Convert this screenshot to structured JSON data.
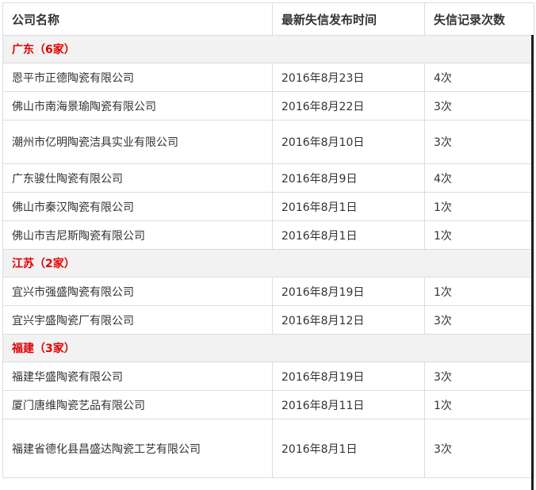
{
  "table": {
    "headers": {
      "company": "公司名称",
      "date": "最新失信发布时间",
      "count": "失信记录次数"
    },
    "groups": [
      {
        "title": "广东（6家）",
        "rows": [
          {
            "company": "恩平市正德陶瓷有限公司",
            "date": "2016年8月23日",
            "count": "4次"
          },
          {
            "company": "佛山市南海景瑜陶瓷有限公司",
            "date": "2016年8月22日",
            "count": "3次"
          },
          {
            "company": "潮州市亿明陶瓷洁具实业有限公司",
            "date": "2016年8月10日",
            "count": "3次"
          },
          {
            "company": "广东骏仕陶瓷有限公司",
            "date": "2016年8月9日",
            "count": "4次"
          },
          {
            "company": "佛山市秦汉陶瓷有限公司",
            "date": "2016年8月1日",
            "count": "1次"
          },
          {
            "company": "佛山市吉尼斯陶瓷有限公司",
            "date": "2016年8月1日",
            "count": "1次"
          }
        ]
      },
      {
        "title": "江苏（2家）",
        "rows": [
          {
            "company": "宜兴市强盛陶瓷有限公司",
            "date": "2016年8月19日",
            "count": "1次"
          },
          {
            "company": "宜兴宇盛陶瓷厂有限公司",
            "date": "2016年8月12日",
            "count": "3次"
          }
        ]
      },
      {
        "title": "福建（3家）",
        "rows": [
          {
            "company": "福建华盛陶瓷有限公司",
            "date": "2016年8月19日",
            "count": "3次"
          },
          {
            "company": "厦门唐维陶瓷艺品有限公司",
            "date": "2016年8月11日",
            "count": "1次"
          },
          {
            "company": "福建省德化县昌盛达陶瓷工艺有限公司",
            "date": "2016年8月1日",
            "count": "3次"
          }
        ]
      }
    ]
  },
  "colors": {
    "group_title": "#e00000",
    "group_bg": "#f2f2f2",
    "border": "#dcdcdc",
    "text": "#333333"
  }
}
